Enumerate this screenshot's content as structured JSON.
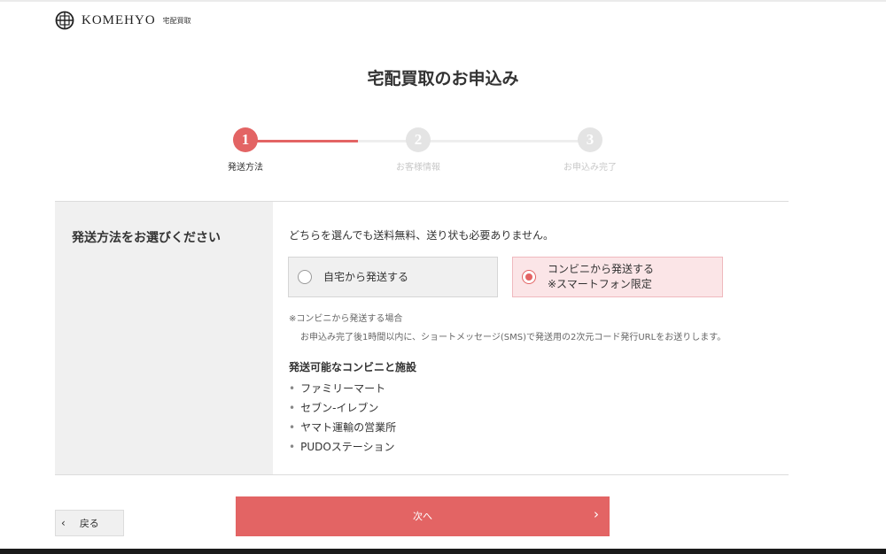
{
  "header": {
    "brand": "KOMEHYO",
    "service": "宅配買取"
  },
  "page": {
    "title": "宅配買取のお申込み"
  },
  "steps": [
    {
      "number": "1",
      "label": "発送方法",
      "state": "active"
    },
    {
      "number": "2",
      "label": "お客様情報",
      "state": "inactive"
    },
    {
      "number": "3",
      "label": "お申込み完了",
      "state": "inactive"
    }
  ],
  "shipping": {
    "question": "発送方法をお選びください",
    "intro": "どちらを選んでも送料無料、送り状も必要ありません。",
    "options": [
      {
        "label": "自宅から発送する",
        "selected": false
      },
      {
        "label": "コンビニから発送する",
        "sublabel": "※スマートフォン限定",
        "selected": true
      }
    ],
    "note_title": "※コンビニから発送する場合",
    "note_body": "お申込み完了後1時間以内に、ショートメッセージ(SMS)で発送用の2次元コード発行URLをお送りします。",
    "stores_heading": "発送可能なコンビニと施設",
    "stores": [
      "ファミリーマート",
      "セブン-イレブン",
      "ヤマト運輸の営業所",
      "PUDOステーション"
    ]
  },
  "buttons": {
    "back": "戻る",
    "next": "次へ"
  },
  "colors": {
    "accent": "#e36464",
    "selected_bg": "#fbe5e7",
    "panel_bg": "#f0f0f0"
  },
  "icons": {
    "back": "chevron-left-icon",
    "next": "chevron-right-icon",
    "radio_on": "radio-selected-icon",
    "radio_off": "radio-unselected-icon"
  }
}
